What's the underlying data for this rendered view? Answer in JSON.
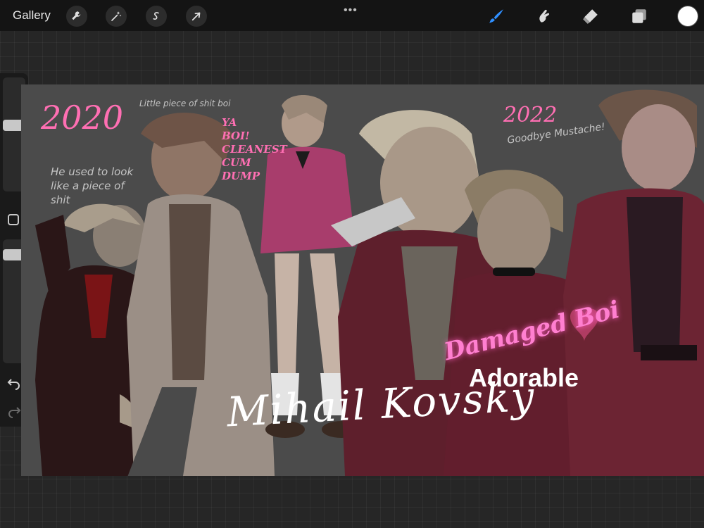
{
  "topbar": {
    "gallery_label": "Gallery",
    "left_tools": [
      {
        "name": "actions",
        "icon": "wrench-icon"
      },
      {
        "name": "adjustments",
        "icon": "magic-wand-icon"
      },
      {
        "name": "selection",
        "icon": "selection-s-icon"
      },
      {
        "name": "transform",
        "icon": "arrow-cursor-icon"
      }
    ],
    "more_label": "•••",
    "right_tools": [
      {
        "name": "brush",
        "icon": "brush-icon",
        "active": true,
        "color": "#2f8fff"
      },
      {
        "name": "smudge",
        "icon": "smudge-finger-icon",
        "active": false
      },
      {
        "name": "eraser",
        "icon": "eraser-icon",
        "active": false
      },
      {
        "name": "layers",
        "icon": "layers-icon",
        "active": false
      }
    ],
    "current_color": "#ffffff"
  },
  "sidebar": {
    "brush_size_slider": "brush-size",
    "opacity_slider": "brush-opacity",
    "modify_button": "square-icon",
    "undo": "undo-arrow-icon",
    "redo": "redo-arrow-icon"
  },
  "canvas_text": {
    "year_left": "2020",
    "note_left": "He used to look like a piece of shit",
    "note_top": "Little piece of shit boi",
    "pink_vertical": "YA BOI! CLEANEST CUM DUMP",
    "year_right": "2022",
    "note_right": "Goodbye Mustache!",
    "pink_neon": "Damaged Boi",
    "adorable": "Adorable",
    "signature": "Mihail Kovsky"
  },
  "colors": {
    "canvas_bg": "#4b4b4b",
    "pink_accent": "#ff6fb3",
    "brush_active": "#2f8fff"
  }
}
